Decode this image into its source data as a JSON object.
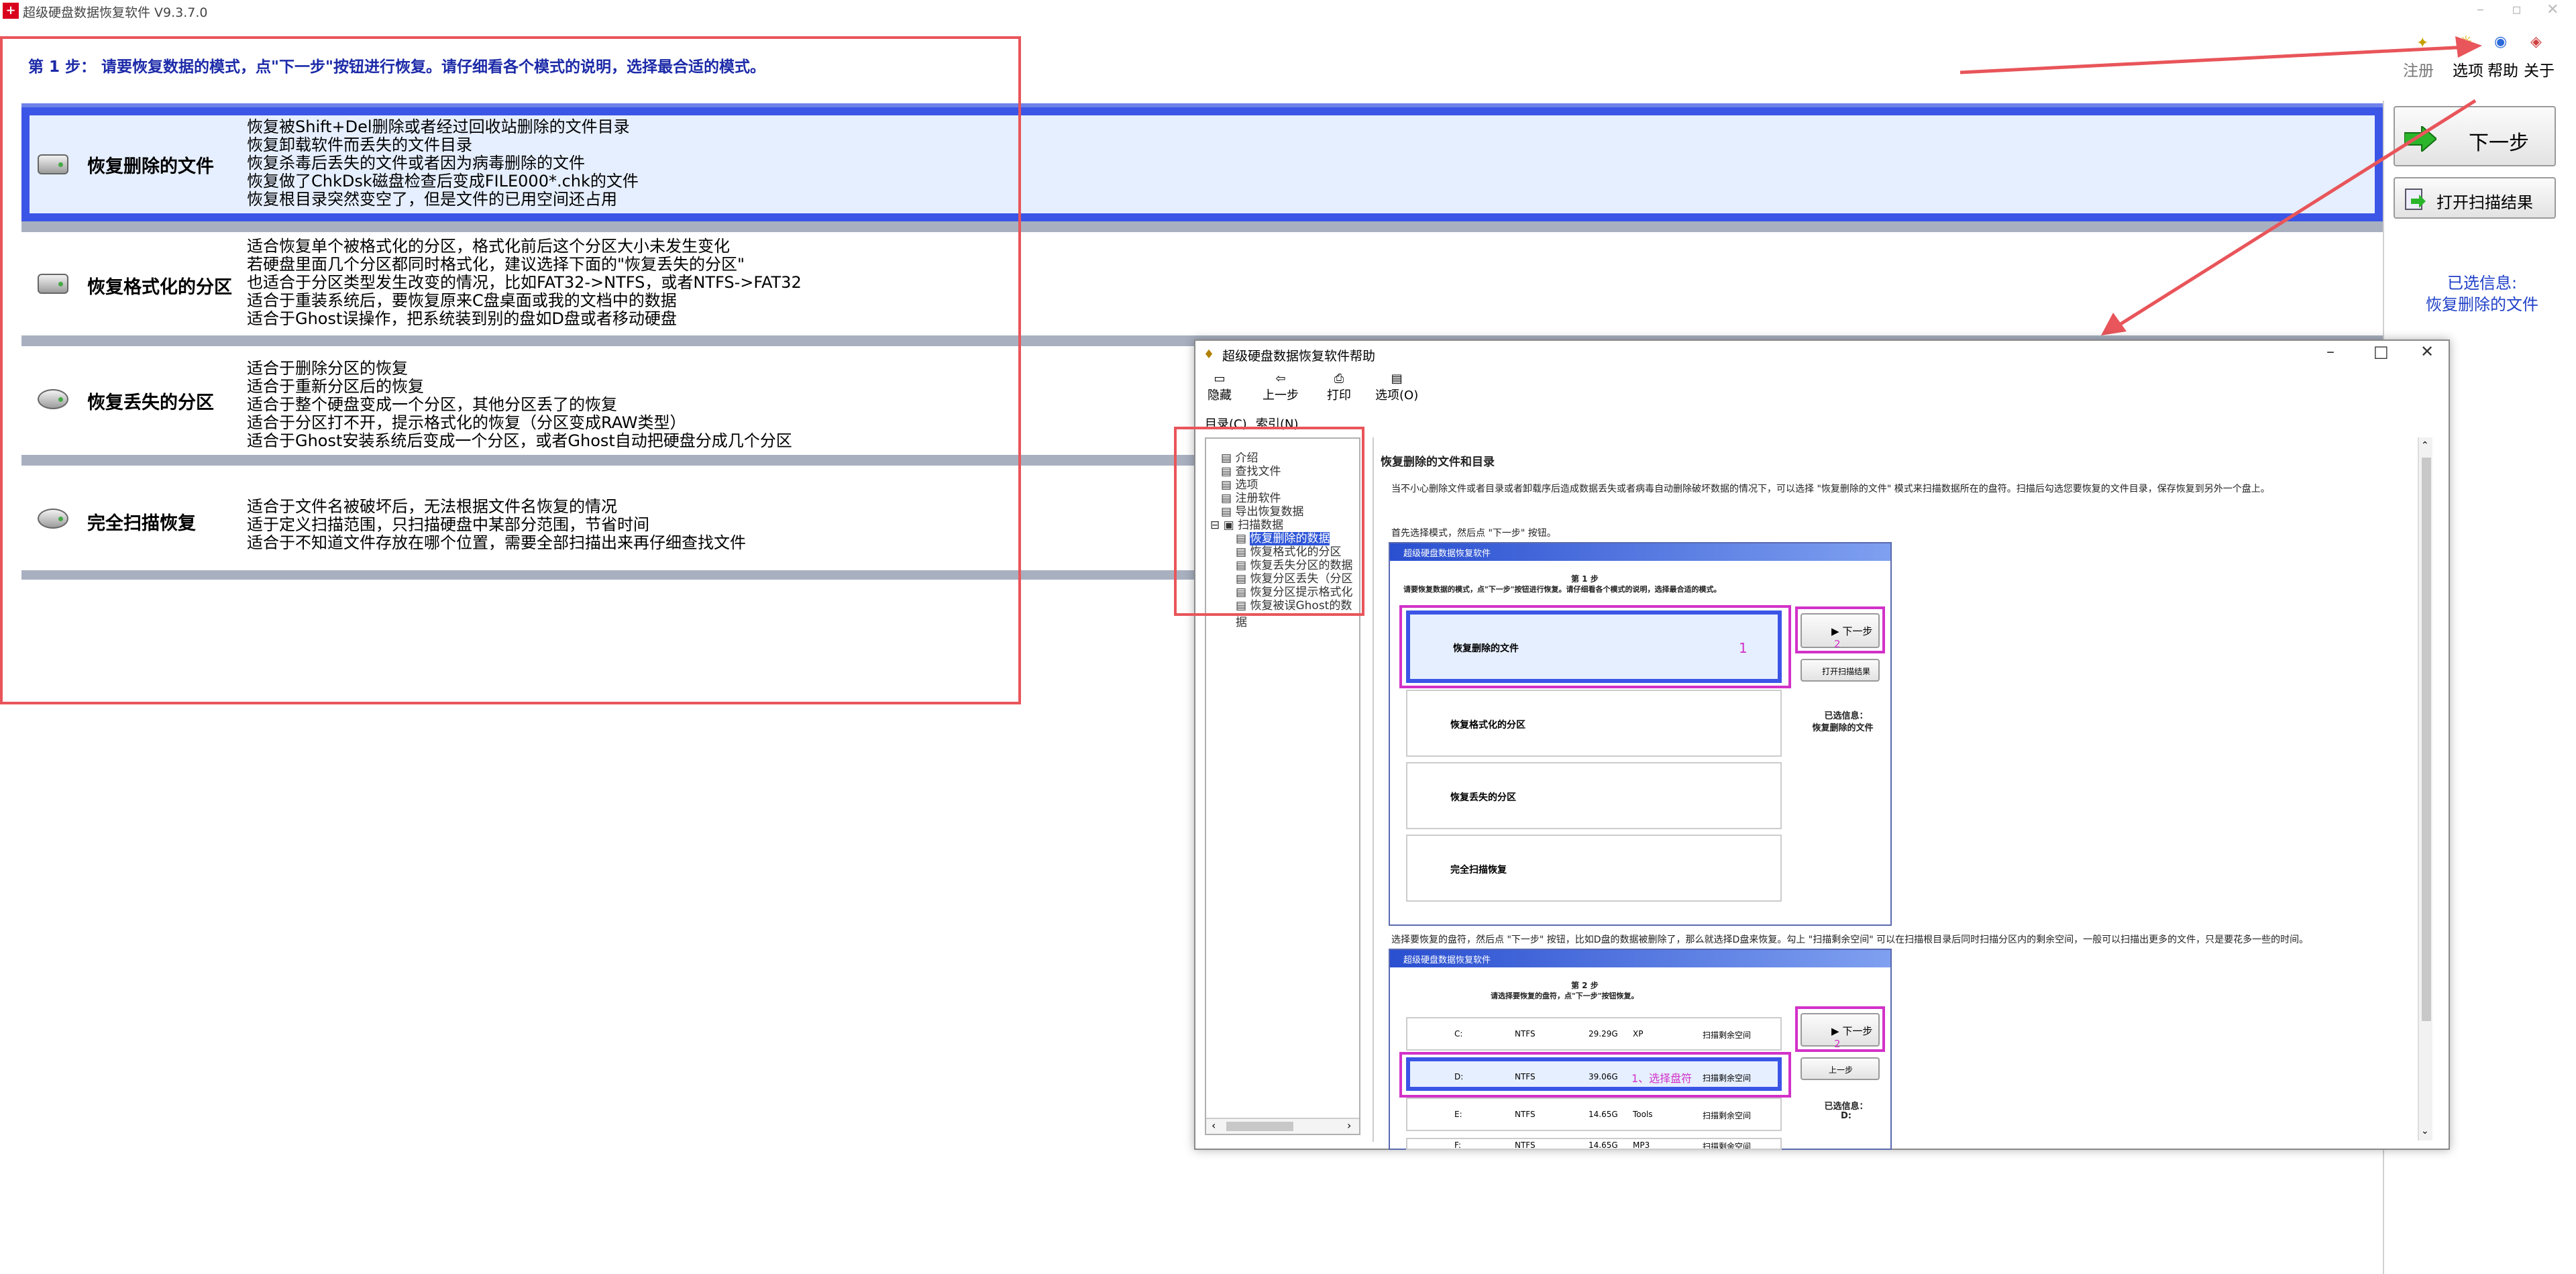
{
  "window": {
    "title": "超级硬盘数据恢复软件 V9.3.7.0",
    "app_icon": "plus-icon"
  },
  "header": {
    "step_text": "第 1 步：  请要恢复数据的模式，点\"下一步\"按钮进行恢复。请仔细看各个模式的说明，选择最合适的模式。"
  },
  "toolbar": {
    "register": "注册",
    "options": "选项",
    "help": "帮助",
    "about": "关于"
  },
  "options": [
    {
      "label": "恢复删除的文件",
      "lines": [
        "恢复被Shift+Del删除或者经过回收站删除的文件目录",
        "恢复卸载软件而丢失的文件目录",
        "恢复杀毒后丢失的文件或者因为病毒删除的文件",
        "恢复做了ChkDsk磁盘检查后变成FILE000*.chk的文件",
        "恢复根目录突然变空了，但是文件的已用空间还占用"
      ]
    },
    {
      "label": "恢复格式化的分区",
      "lines": [
        "适合恢复单个被格式化的分区，格式化前后这个分区大小未发生变化",
        "若硬盘里面几个分区都同时格式化，建议选择下面的\"恢复丢失的分区\"",
        "也适合于分区类型发生改变的情况，比如FAT32->NTFS，或者NTFS->FAT32",
        "适合于重装系统后，要恢复原来C盘桌面或我的文档中的数据",
        "适合于Ghost误操作，把系统装到别的盘如D盘或者移动硬盘"
      ]
    },
    {
      "label": "恢复丢失的分区",
      "lines": [
        "适合于删除分区的恢复",
        "适合于重新分区后的恢复",
        "适合于整个硬盘变成一个分区，其他分区丢了的恢复",
        "适合于分区打不开，提示格式化的恢复（分区变成RAW类型）",
        "适合于Ghost安装系统后变成一个分区，或者Ghost自动把硬盘分成几个分区"
      ]
    },
    {
      "label": "完全扫描恢复",
      "lines": [
        "适合于文件名被破坏后，无法根据文件名恢复的情况",
        "适于定义扫描范围，只扫描硬盘中某部分范围，节省时间",
        "适合于不知道文件存放在哪个位置，需要全部扫描出来再仔细查找文件"
      ]
    }
  ],
  "buttons": {
    "next": "下一步",
    "open_scan": "打开扫描结果"
  },
  "selected_info": {
    "title": "已选信息:",
    "value": "恢复删除的文件"
  },
  "help_window": {
    "title": "超级硬盘数据恢复软件帮助",
    "tools": [
      "隐藏",
      "上一步",
      "打印",
      "选项(O)"
    ],
    "tabs": [
      "目录(C)",
      "索引(N)"
    ],
    "tree": [
      "介绍",
      "查找文件",
      "选项",
      "注册软件",
      "导出恢复数据",
      "扫描数据",
      "恢复删除的数据",
      "恢复格式化的分区",
      "恢复丢失分区的数据",
      "恢复分区丢失（分区",
      "恢复分区提示格式化",
      "恢复被误Ghost的数据"
    ],
    "heading": "恢复删除的文件和目录",
    "para1": "当不小心删除文件或者目录或者卸载序后造成数据丢失或者病毒自动删除破坏数据的情况下，可以选择 \"恢复删除的文件\" 模式来扫描数据所在的盘符。扫描后勾选您要恢复的文件目录，保存恢复到另外一个盘上。",
    "para2": "首先选择模式，然后点 \"下一步\" 按钮。",
    "para3": "选择要恢复的盘符，然后点 \"下一步\" 按钮，比如D盘的数据被删除了，那么就选择D盘来恢复。勾上 \"扫描剩余空间\" 可以在扫描根目录后同时扫描分区内的剩余空间，一般可以扫描出更多的文件，只是要花多一些的时间。",
    "thumb1": {
      "title": "超级硬盘数据恢复软件",
      "step": "第 1 步",
      "step_desc": "请要恢复数据的模式，点\"下一步\"按钮进行恢复。请仔细看各个模式的说明，选择最合适的模式。",
      "rows": [
        "恢复删除的文件",
        "恢复格式化的分区",
        "恢复丢失的分区",
        "完全扫描恢复"
      ],
      "next": "下一步",
      "open": "打开扫描结果",
      "info": "已选信息：",
      "info_val": "恢复删除的文件",
      "mark1": "1",
      "mark2": "2"
    },
    "thumb2": {
      "title": "超级硬盘数据恢复软件",
      "step": "第 2 步",
      "step_desc": "请选择要恢复的盘符，点\"下一步\"按钮恢复。",
      "disks": [
        {
          "drv": "C:",
          "fs": "NTFS",
          "size": "29.29G",
          "label": "XP",
          "scan": "扫描剩余空间"
        },
        {
          "drv": "D:",
          "fs": "NTFS",
          "size": "39.06G",
          "label": "1、选择盘符",
          "scan": "扫描剩余空间"
        },
        {
          "drv": "E:",
          "fs": "NTFS",
          "size": "14.65G",
          "label": "Tools",
          "scan": "扫描剩余空间"
        },
        {
          "drv": "F:",
          "fs": "NTFS",
          "size": "14.65G",
          "label": "MP3",
          "scan": "扫描剩余空间"
        }
      ],
      "next": "下一步",
      "prev": "上一步",
      "info": "已选信息：",
      "info_val": "D:",
      "mark2": "2"
    }
  }
}
